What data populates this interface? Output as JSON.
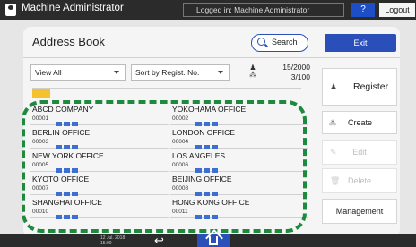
{
  "topbar": {
    "title": "Machine Administrator",
    "login_status": "Logged in: Machine Administrator",
    "help_label": "?",
    "logout_label": "Logout"
  },
  "page": {
    "title": "Address Book",
    "search_label": "Search",
    "exit_label": "Exit"
  },
  "filters": {
    "view": "View All",
    "sort": "Sort by Regist. No."
  },
  "counter": {
    "page": "15/2000",
    "total": "3/100"
  },
  "side_actions": {
    "register": "Register",
    "create_group": "Create Group",
    "edit": "Edit",
    "delete": "Delete",
    "management": "Management"
  },
  "entries": [
    {
      "name": "ABCD COMPANY",
      "number": "00001"
    },
    {
      "name": "YOKOHAMA OFFICE",
      "number": "00002"
    },
    {
      "name": "BERLIN OFFICE",
      "number": "00003"
    },
    {
      "name": "LONDON OFFICE",
      "number": "00004"
    },
    {
      "name": "NEW YORK OFFICE",
      "number": "00005"
    },
    {
      "name": "LOS ANGELES",
      "number": "00006"
    },
    {
      "name": "KYOTO OFFICE",
      "number": "00007"
    },
    {
      "name": "BEIJING OFFICE",
      "number": "00008"
    },
    {
      "name": "SHANGHAI OFFICE",
      "number": "00010"
    },
    {
      "name": "HONG KONG OFFICE",
      "number": "00011"
    }
  ],
  "bottombar": {
    "date": "12 Jul. 2018",
    "time": "15:00"
  },
  "colors": {
    "accent": "#2a4fb8",
    "highlight_dashes": "#1e8a3e",
    "index_tab": "#f3c22e"
  }
}
